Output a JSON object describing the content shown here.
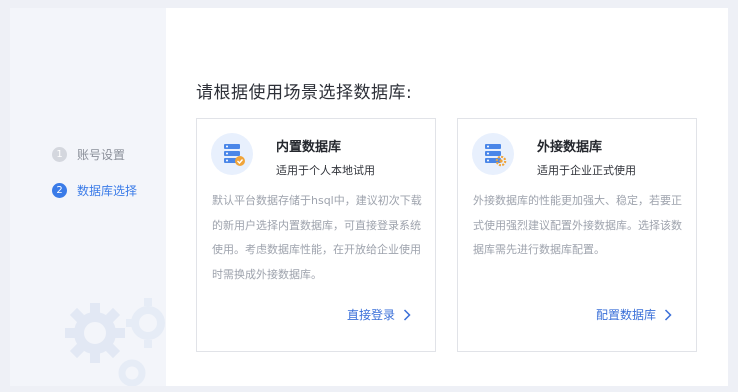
{
  "sidebar": {
    "steps": [
      {
        "num": "1",
        "label": "账号设置"
      },
      {
        "num": "2",
        "label": "数据库选择"
      }
    ]
  },
  "main": {
    "heading": "请根据使用场景选择数据库:",
    "cards": [
      {
        "title": "内置数据库",
        "subtitle": "适用于个人本地试用",
        "description": "默认平台数据存储于hsql中，建议初次下载的新用户选择内置数据库，可直接登录系统使用。考虑数据库性能，在开放给企业使用时需换成外接数据库。",
        "action": "直接登录",
        "icon": "database-check-icon",
        "badge_color": "#f0a43a"
      },
      {
        "title": "外接数据库",
        "subtitle": "适用于企业正式使用",
        "description": "外接数据库的性能更加强大、稳定，若要正式使用强烈建议配置外接数据库。选择该数据库需先进行数据库配置。",
        "action": "配置数据库",
        "icon": "database-gear-icon",
        "badge_color": "#f0a43a"
      }
    ]
  },
  "colors": {
    "accent": "#3a7be8",
    "link": "#3a6fd8",
    "step_done": "#d4d7de"
  }
}
